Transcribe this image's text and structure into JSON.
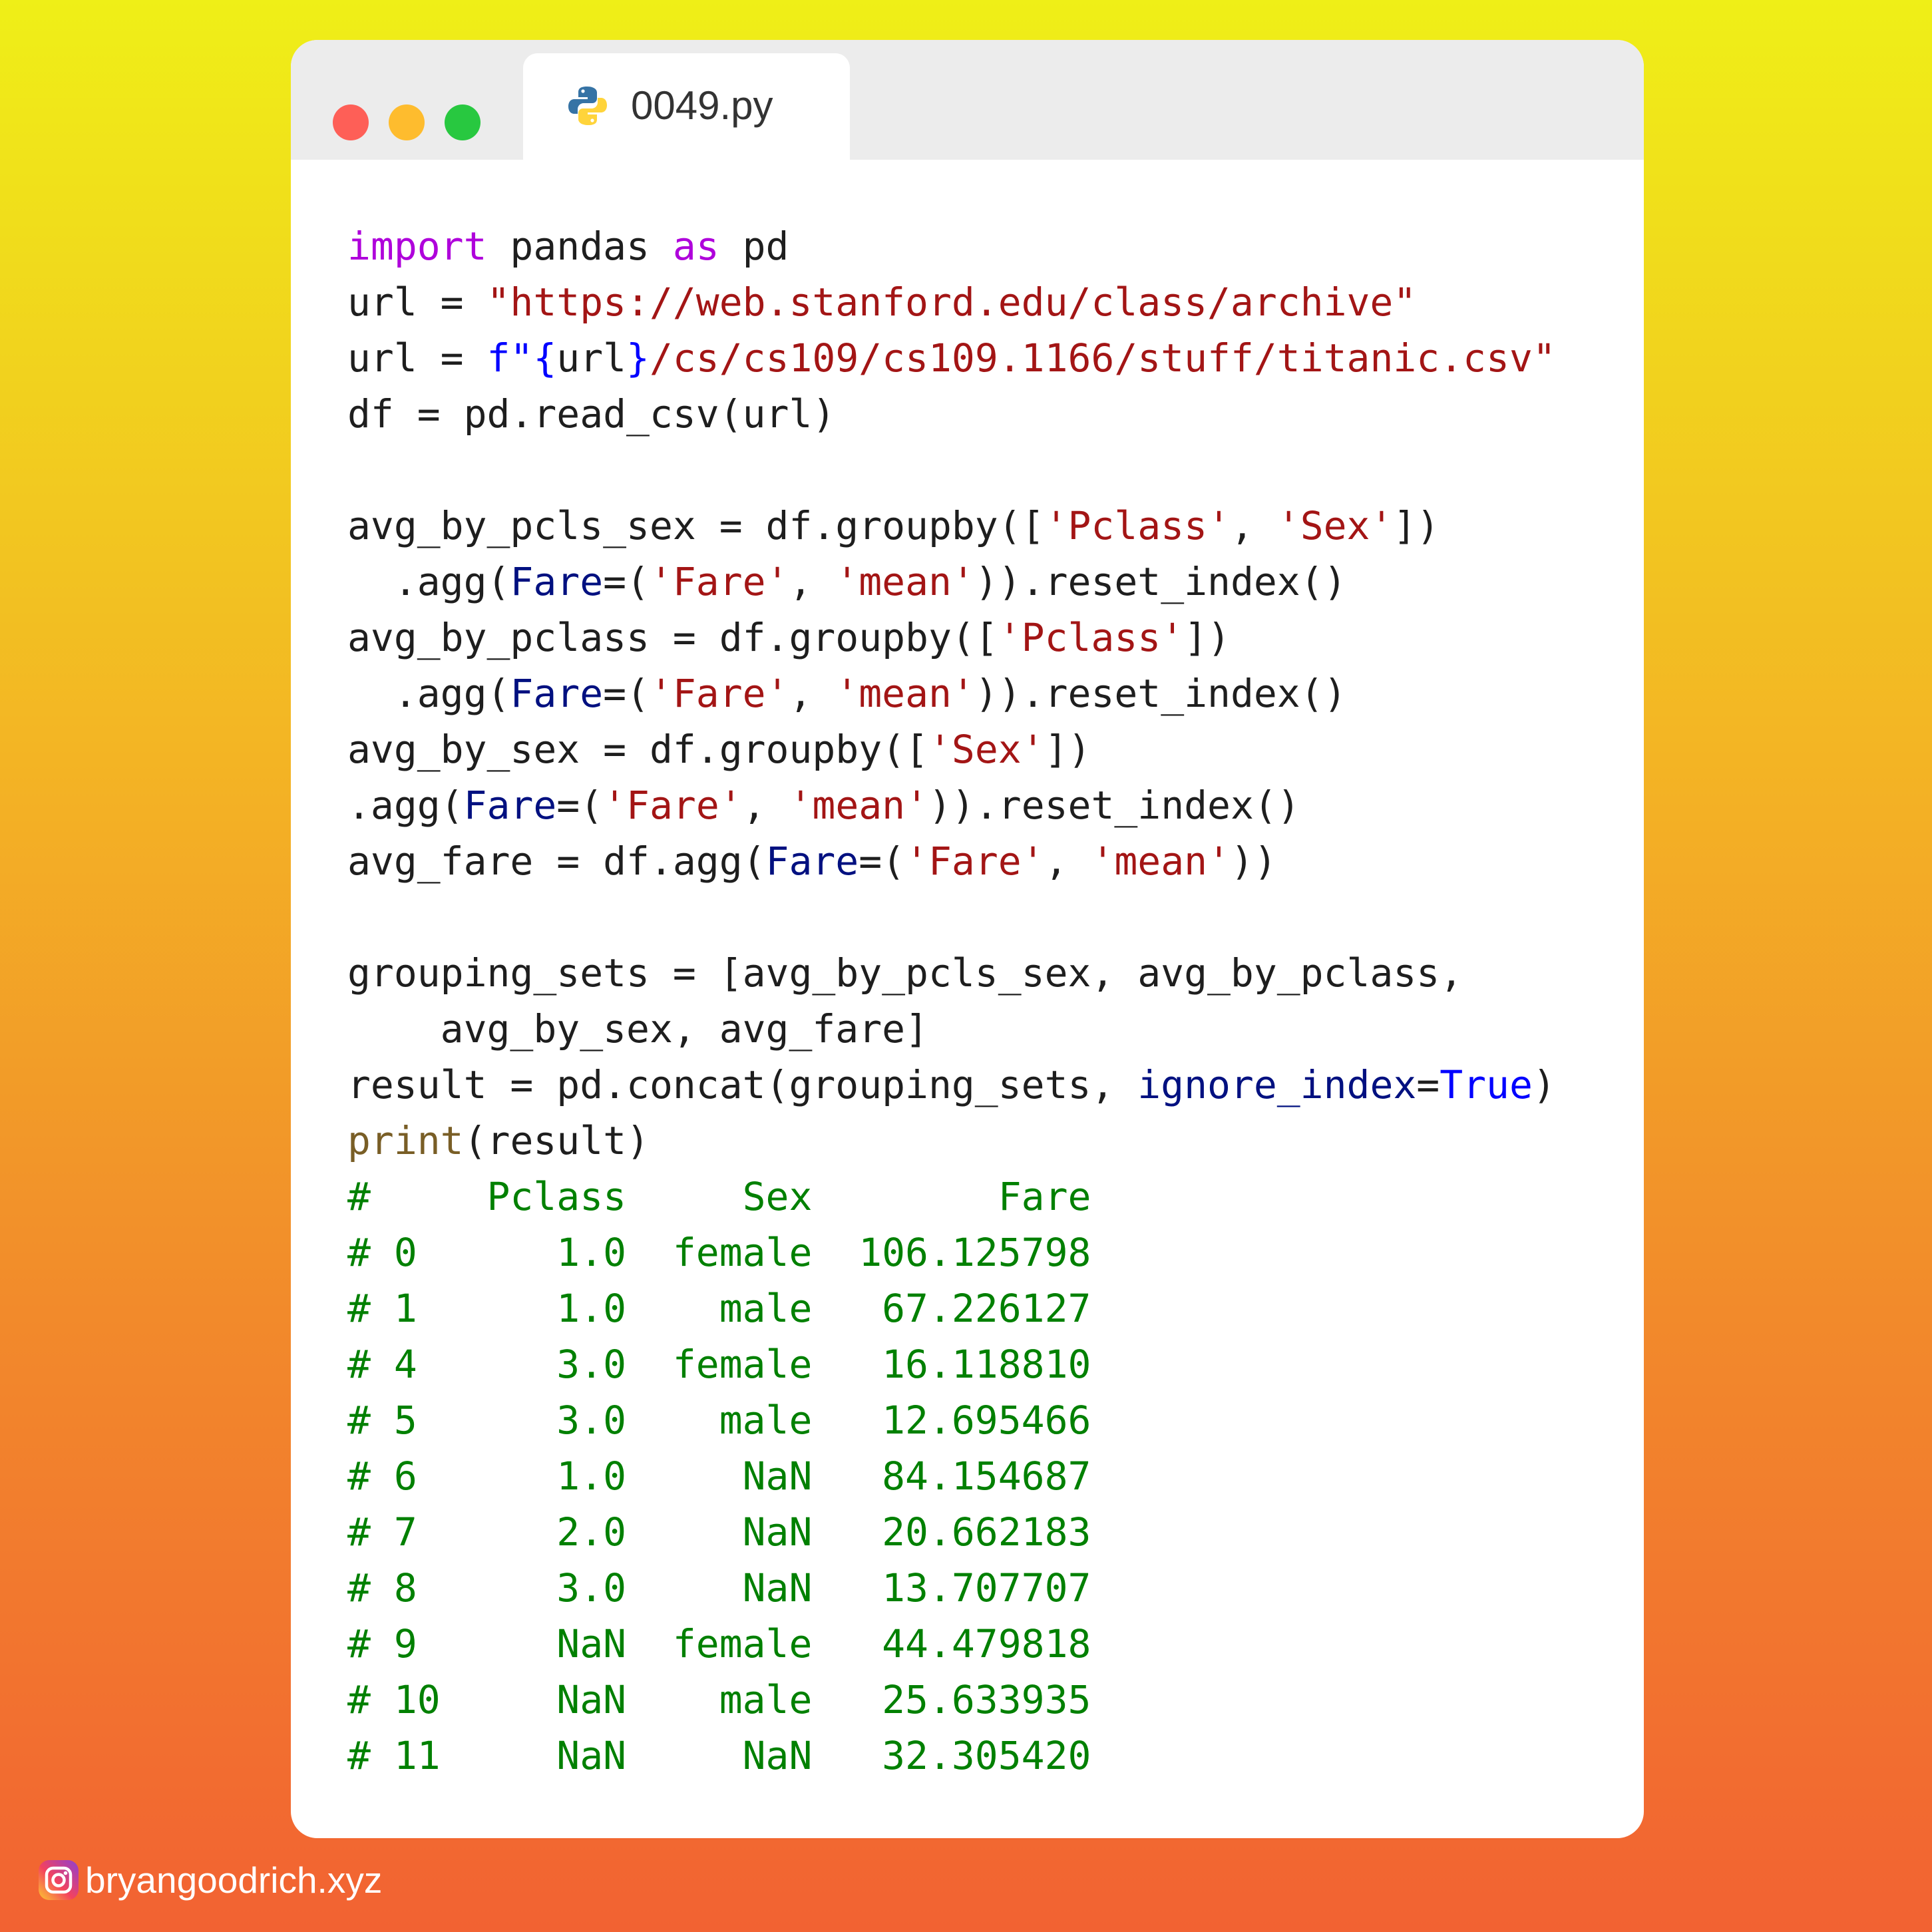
{
  "window": {
    "tab_title": "0049.py",
    "tab_icon": "python-icon",
    "controls": [
      "close-dot",
      "minimize-dot",
      "maximize-dot"
    ]
  },
  "code": {
    "lines": [
      [
        {
          "t": "import",
          "k": "kw"
        },
        {
          "t": " pandas "
        },
        {
          "t": "as",
          "k": "kw"
        },
        {
          "t": " pd"
        }
      ],
      [
        {
          "t": "url = "
        },
        {
          "t": "\"https://web.stanford.edu/class/archive\"",
          "k": "str"
        }
      ],
      [
        {
          "t": "url = "
        },
        {
          "t": "f\"",
          "k": "fpre"
        },
        {
          "t": "{",
          "k": "brace"
        },
        {
          "t": "url"
        },
        {
          "t": "}",
          "k": "brace"
        },
        {
          "t": "/cs/cs109/cs109.1166/stuff/titanic.csv\"",
          "k": "str"
        }
      ],
      [
        {
          "t": "df = pd.read_csv(url)"
        }
      ],
      [],
      [
        {
          "t": "avg_by_pcls_sex = df.groupby(["
        },
        {
          "t": "'Pclass'",
          "k": "str"
        },
        {
          "t": ", "
        },
        {
          "t": "'Sex'",
          "k": "str"
        },
        {
          "t": "])"
        }
      ],
      [
        {
          "t": "  .agg("
        },
        {
          "t": "Fare",
          "k": "param"
        },
        {
          "t": "=("
        },
        {
          "t": "'Fare'",
          "k": "str"
        },
        {
          "t": ", "
        },
        {
          "t": "'mean'",
          "k": "str"
        },
        {
          "t": ")).reset_index()"
        }
      ],
      [
        {
          "t": "avg_by_pclass = df.groupby(["
        },
        {
          "t": "'Pclass'",
          "k": "str"
        },
        {
          "t": "])"
        }
      ],
      [
        {
          "t": "  .agg("
        },
        {
          "t": "Fare",
          "k": "param"
        },
        {
          "t": "=("
        },
        {
          "t": "'Fare'",
          "k": "str"
        },
        {
          "t": ", "
        },
        {
          "t": "'mean'",
          "k": "str"
        },
        {
          "t": ")).reset_index()"
        }
      ],
      [
        {
          "t": "avg_by_sex = df.groupby(["
        },
        {
          "t": "'Sex'",
          "k": "str"
        },
        {
          "t": "])"
        }
      ],
      [
        {
          "t": ".agg("
        },
        {
          "t": "Fare",
          "k": "param"
        },
        {
          "t": "=("
        },
        {
          "t": "'Fare'",
          "k": "str"
        },
        {
          "t": ", "
        },
        {
          "t": "'mean'",
          "k": "str"
        },
        {
          "t": ")).reset_index()"
        }
      ],
      [
        {
          "t": "avg_fare = df.agg("
        },
        {
          "t": "Fare",
          "k": "param"
        },
        {
          "t": "=("
        },
        {
          "t": "'Fare'",
          "k": "str"
        },
        {
          "t": ", "
        },
        {
          "t": "'mean'",
          "k": "str"
        },
        {
          "t": "))"
        }
      ],
      [],
      [
        {
          "t": "grouping_sets = [avg_by_pcls_sex, avg_by_pclass,"
        }
      ],
      [
        {
          "t": "    avg_by_sex, avg_fare]"
        }
      ],
      [
        {
          "t": "result = pd.concat(grouping_sets, "
        },
        {
          "t": "ignore_index",
          "k": "param"
        },
        {
          "t": "="
        },
        {
          "t": "True",
          "k": "cnst"
        },
        {
          "t": ")"
        }
      ],
      [
        {
          "t": "print",
          "k": "fn"
        },
        {
          "t": "(result)"
        }
      ],
      [
        {
          "t": "#     Pclass     Sex        Fare",
          "k": "cm"
        }
      ],
      [
        {
          "t": "# 0      1.0  female  106.125798",
          "k": "cm"
        }
      ],
      [
        {
          "t": "# 1      1.0    male   67.226127",
          "k": "cm"
        }
      ],
      [
        {
          "t": "# 4      3.0  female   16.118810",
          "k": "cm"
        }
      ],
      [
        {
          "t": "# 5      3.0    male   12.695466",
          "k": "cm"
        }
      ],
      [
        {
          "t": "# 6      1.0     NaN   84.154687",
          "k": "cm"
        }
      ],
      [
        {
          "t": "# 7      2.0     NaN   20.662183",
          "k": "cm"
        }
      ],
      [
        {
          "t": "# 8      3.0     NaN   13.707707",
          "k": "cm"
        }
      ],
      [
        {
          "t": "# 9      NaN  female   44.479818",
          "k": "cm"
        }
      ],
      [
        {
          "t": "# 10     NaN    male   25.633935",
          "k": "cm"
        }
      ],
      [
        {
          "t": "# 11     NaN     NaN   32.305420",
          "k": "cm"
        }
      ]
    ]
  },
  "footer": {
    "icon": "instagram-icon",
    "handle": "bryangoodrich.xyz"
  },
  "colors": {
    "keyword": "#af00db",
    "string": "#a31515",
    "parameter": "#001080",
    "constant": "#0000ff",
    "function": "#795e26",
    "comment": "#008000",
    "text": "#1e1e1e",
    "close": "#fe5f57",
    "minimize": "#febc2e",
    "maximize": "#28c840"
  }
}
